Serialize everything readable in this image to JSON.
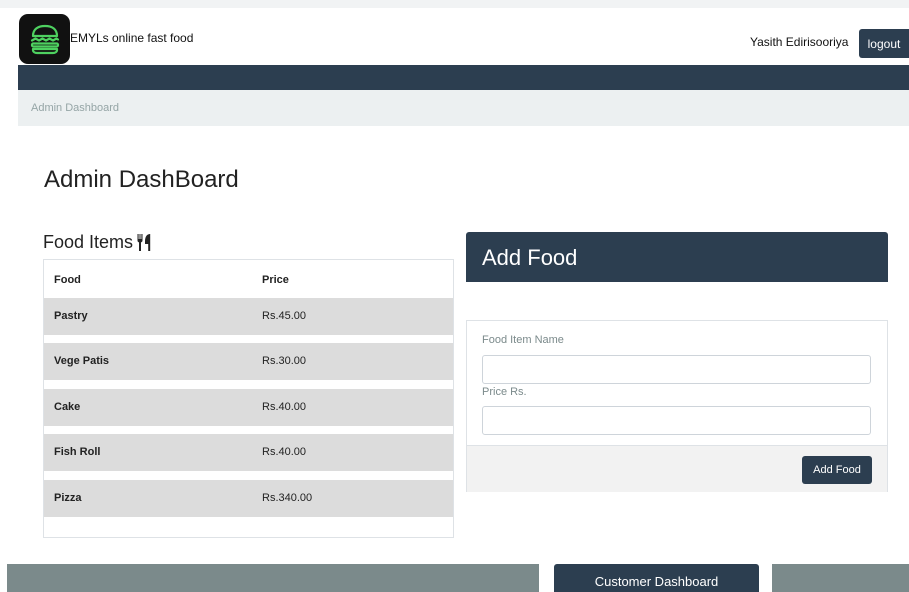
{
  "header": {
    "brand": "EMYLs online fast food",
    "logo_icon": "burger-icon",
    "username": "Yasith Edirisooriya",
    "logout_label": "logout"
  },
  "breadcrumb": {
    "label": "Admin Dashboard"
  },
  "page_title": "Admin DashBoard",
  "food_items": {
    "title": "Food Items",
    "icon": "utensils-icon",
    "columns": [
      "Food",
      "Price"
    ],
    "rows": [
      {
        "food": "Pastry",
        "price": "Rs.45.00"
      },
      {
        "food": "Vege Patis",
        "price": "Rs.30.00"
      },
      {
        "food": "Cake",
        "price": "Rs.40.00"
      },
      {
        "food": "Fish Roll",
        "price": "Rs.40.00"
      },
      {
        "food": "Pizza",
        "price": "Rs.340.00"
      }
    ]
  },
  "add_food": {
    "title": "Add Food",
    "name_label": "Food Item Name",
    "name_value": "",
    "price_label": "Price Rs.",
    "price_value": "",
    "submit_label": "Add Food"
  },
  "footer": {
    "customer_button_label": "Customer Dashboard"
  },
  "colors": {
    "primary": "#2c3e50",
    "secondary": "#7b8a8b",
    "light": "#ecf0f1",
    "logo_green": "#4ed160"
  }
}
